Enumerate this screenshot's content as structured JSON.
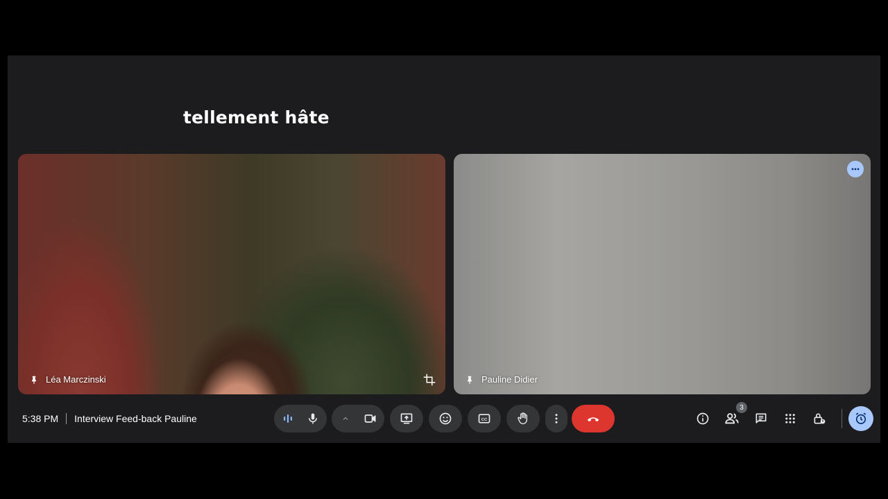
{
  "caption": {
    "text": "tellement hâte"
  },
  "participants": [
    {
      "name": "Léa Marczinski"
    },
    {
      "name": "Pauline Didier"
    }
  ],
  "meeting": {
    "time": "5:38 PM",
    "title": "Interview Feed-back Pauline"
  },
  "controls": {
    "audio_level_icon": "audio-level-icon",
    "mic_icon": "mic-icon",
    "camera_options_icon": "chevron-up-icon",
    "camera_icon": "videocam-icon",
    "present_icon": "present-screen-icon",
    "reactions_icon": "emoji-icon",
    "captions_icon": "closed-captions-icon",
    "raise_hand_icon": "raise-hand-icon",
    "more_icon": "more-vert-icon",
    "end_call_icon": "call-end-icon"
  },
  "side_controls": {
    "info_icon": "info-icon",
    "people_icon": "people-icon",
    "people_count": "3",
    "chat_icon": "chat-icon",
    "activities_icon": "apps-grid-icon",
    "host_controls_icon": "lock-person-icon",
    "timer_icon": "alarm-icon"
  },
  "colors": {
    "end_call": "#dc362e",
    "accent": "#a8c7fa",
    "control_bg": "#333537"
  }
}
